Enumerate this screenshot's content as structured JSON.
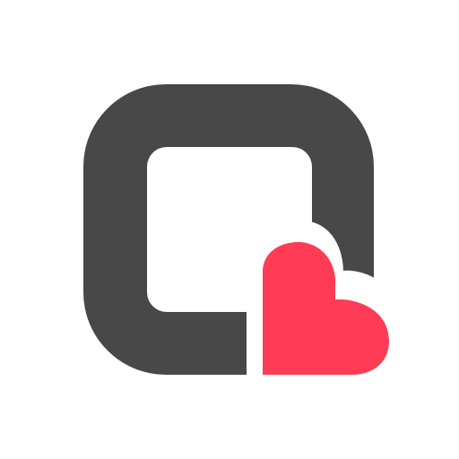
{
  "logo": {
    "icon_name": "rounded-square-heart-logo",
    "square_icon_name": "rounded-square-frame-icon",
    "heart_icon_name": "heart-icon"
  },
  "colors": {
    "background": "#ffffff",
    "frame": "#484848",
    "heart": "#ff3b55"
  }
}
